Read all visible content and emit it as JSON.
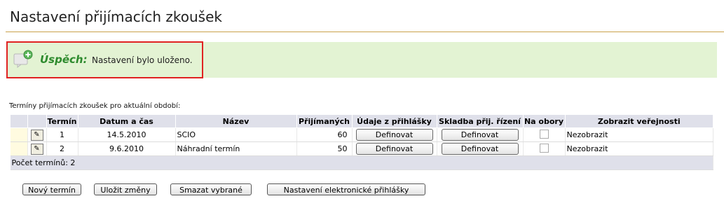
{
  "page": {
    "title": "Nastavení přijímacích zkoušek"
  },
  "alert": {
    "label": "Úspěch:",
    "message": "Nastavení bylo uloženo.",
    "color": "#2e8b2e",
    "background": "#e3f3d3"
  },
  "table": {
    "caption": "Termíny přijímacích zkoušek pro aktuální období:",
    "columns": [
      "",
      "",
      "Termín",
      "Datum a čas",
      "Název",
      "Přijímaných",
      "Údaje z přihlášky",
      "Skladba přij. řízení",
      "Na obory",
      "Zobrazit veřejnosti"
    ],
    "rows": [
      {
        "termin": "1",
        "datum": "14.5.2010",
        "nazev": "SCIO",
        "prijimanych": "60",
        "udaje_btn": "Definovat",
        "skladba_btn": "Definovat",
        "na_obory": false,
        "zobrazit": "Nezobrazit"
      },
      {
        "termin": "2",
        "datum": "9.6.2010",
        "nazev": "Náhradní termín",
        "prijimanych": "50",
        "udaje_btn": "Definovat",
        "skladba_btn": "Definovat",
        "na_obory": false,
        "zobrazit": "Nezobrazit"
      }
    ],
    "footer": "Počet termínů: 2"
  },
  "actions": {
    "new": "Nový termín",
    "save": "Uložit změny",
    "delete": "Smazat vybrané",
    "settings": "Nastavení elektronické přihlášky"
  }
}
